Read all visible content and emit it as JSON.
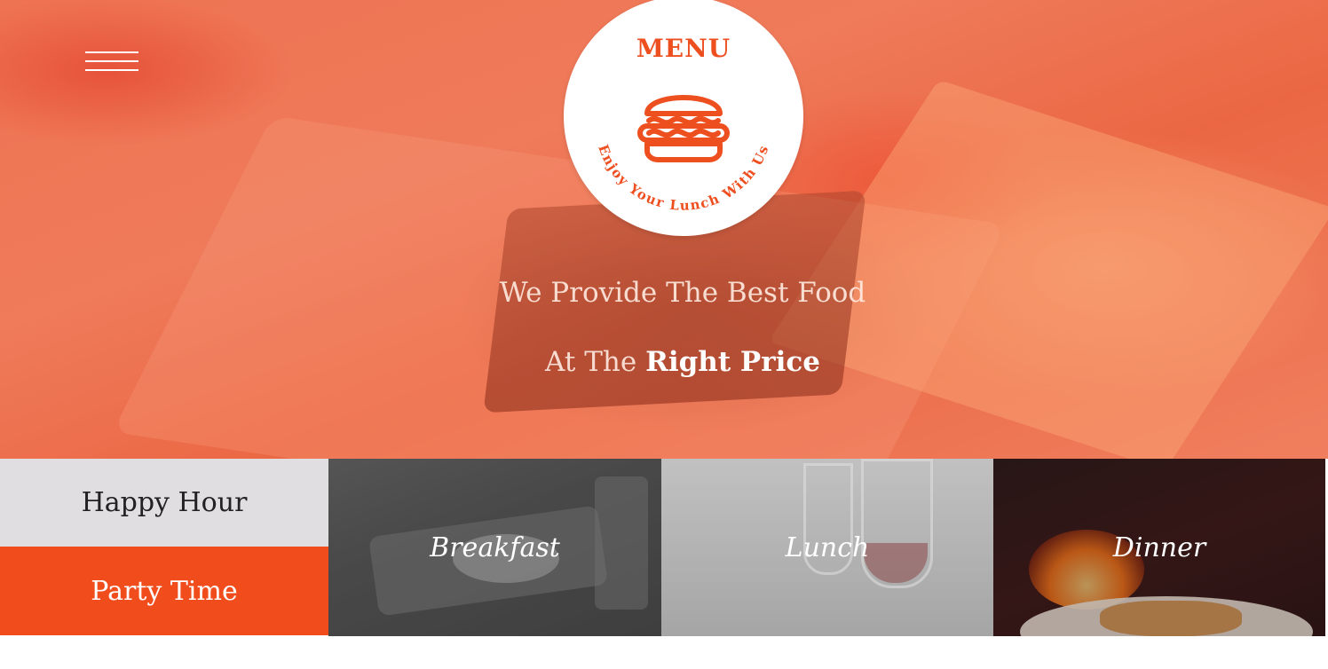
{
  "brand": {
    "logo_title": "MENU",
    "logo_arc_text": "Enjoy Your Lunch With Us",
    "accent_color": "#ee4f1f"
  },
  "nav": {
    "menu_icon": "hamburger-menu-icon"
  },
  "hero": {
    "line1": "We Provide The Best Food",
    "line2_prefix": "At The",
    "line2_highlight": "Right Price"
  },
  "side_buttons": {
    "happy_hour": "Happy Hour",
    "party_time": "Party Time"
  },
  "meals": [
    {
      "label": "Breakfast"
    },
    {
      "label": "Lunch"
    },
    {
      "label": "Dinner"
    }
  ]
}
